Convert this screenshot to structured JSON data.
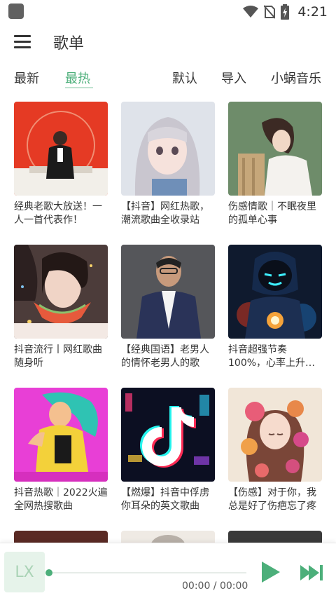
{
  "status_bar": {
    "time": "4:21",
    "icons": [
      "app-icon",
      "wifi-icon",
      "no-sim-icon",
      "battery-charging-icon"
    ]
  },
  "header": {
    "menu_icon": "hamburger-menu-icon",
    "title": "歌单"
  },
  "tabs": {
    "left": [
      {
        "label": "最新",
        "active": false
      },
      {
        "label": "最热",
        "active": true
      }
    ],
    "right": [
      {
        "label": "默认"
      },
      {
        "label": "导入"
      },
      {
        "label": "小蜗音乐"
      }
    ]
  },
  "playlists": [
    {
      "title": "经典老歌大放送！一人一首代表作！"
    },
    {
      "title": "【抖音】网红热歌，潮流歌曲全收录站"
    },
    {
      "title": "伤感情歌｜不眠夜里的孤单心事"
    },
    {
      "title": "抖音流行丨网红歌曲随身听"
    },
    {
      "title": "【经典国语】老男人的情怀老男人的歌"
    },
    {
      "title": "抖音超强节奏100%，心率上升M..."
    },
    {
      "title": "抖音热歌｜2022火遍全网热搜歌曲"
    },
    {
      "title": "【燃爆】抖音中俘虏你耳朵的英文歌曲"
    },
    {
      "title": "【伤感】对于你，我总是好了伤疤忘了疼"
    }
  ],
  "player": {
    "art_text": "LX",
    "time": "00:00 / 00:00",
    "progress": 0,
    "accent_color": "#4caf7a",
    "icons": [
      "play-icon",
      "next-track-icon"
    ]
  }
}
